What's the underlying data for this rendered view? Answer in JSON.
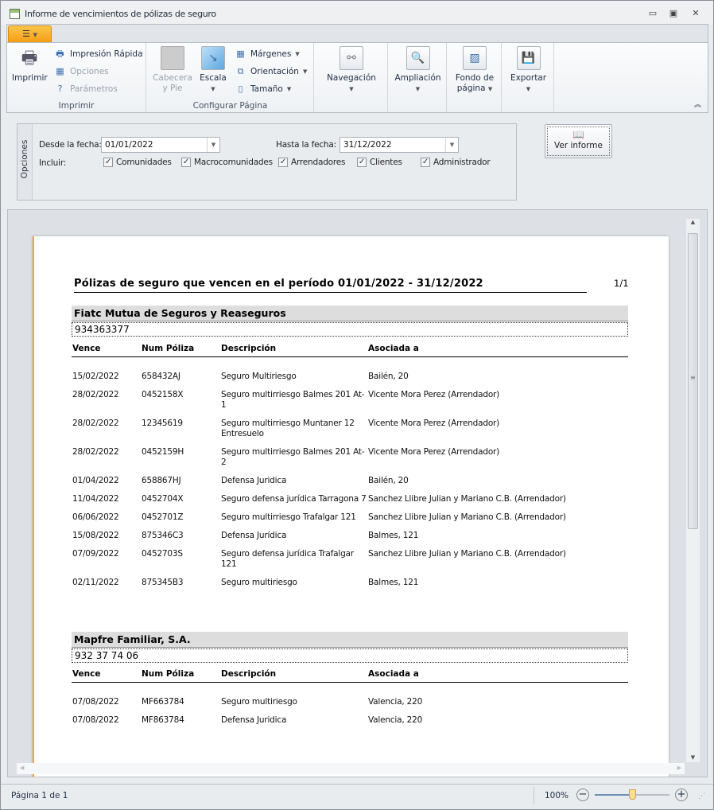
{
  "window": {
    "title": "Informe de vencimientos de pólizas de seguro"
  },
  "ribbon": {
    "imprimir_group": {
      "label": "Imprimir",
      "print": "Imprimir",
      "quick_print": "Impresión Rápida",
      "options": "Opciones",
      "parameters": "Parámetros"
    },
    "config_group": {
      "label": "Configurar Página",
      "header_footer_1": "Cabecera",
      "header_footer_2": "y Pie",
      "scale": "Escala",
      "margins": "Márgenes",
      "orientation": "Orientación",
      "size": "Tamaño"
    },
    "navigation": "Navegación",
    "zoom": "Ampliación",
    "background_1": "Fondo de",
    "background_2": "página",
    "export": "Exportar"
  },
  "options": {
    "panel_label": "Opciones",
    "from_label": "Desde la fecha:",
    "from_value": "01/01/2022",
    "to_label": "Hasta la fecha:",
    "to_value": "31/12/2022",
    "include_label": "Incluir:",
    "checks": [
      {
        "label": "Comunidades",
        "checked": true
      },
      {
        "label": "Macrocomunidades",
        "checked": true
      },
      {
        "label": "Arrendadores",
        "checked": true
      },
      {
        "label": "Clientes",
        "checked": true
      },
      {
        "label": "Administrador",
        "checked": true
      }
    ],
    "view_report": "Ver informe"
  },
  "report": {
    "title": "Pólizas de seguro que vencen en el período 01/01/2022 - 31/12/2022",
    "page": "1/1",
    "columns": [
      "Vence",
      "Num Póliza",
      "Descripción",
      "Asociada a"
    ],
    "groups": [
      {
        "name": "Fiatc Mutua de Seguros y Reaseguros",
        "phone": "934363377",
        "rows": [
          [
            "15/02/2022",
            "658432AJ",
            "Seguro Multiriesgo",
            "Bailén, 20"
          ],
          [
            "28/02/2022",
            "0452158X",
            "Seguro multirriesgo Balmes 201 At-1",
            "Vicente Mora Perez (Arrendador)"
          ],
          [
            "28/02/2022",
            "12345619",
            "Seguro multirriesgo Muntaner 12 Entresuelo",
            "Vicente Mora Perez (Arrendador)"
          ],
          [
            "28/02/2022",
            "0452159H",
            "Seguro multirriesgo Balmes 201 At-2",
            "Vicente Mora Perez (Arrendador)"
          ],
          [
            "01/04/2022",
            "658867HJ",
            "Defensa Juridica",
            "Bailén, 20"
          ],
          [
            "11/04/2022",
            "0452704X",
            "Seguro defensa jurídica Tarragona 7",
            "Sanchez Llibre Julian y Mariano C.B. (Arrendador)"
          ],
          [
            "06/06/2022",
            "0452701Z",
            "Seguro multirriesgo Trafalgar 121",
            "Sanchez Llibre Julian y Mariano C.B. (Arrendador)"
          ],
          [
            "15/08/2022",
            "875346C3",
            "Defensa Jurídica",
            "Balmes, 121"
          ],
          [
            "07/09/2022",
            "0452703S",
            "Seguro defensa jurídica Trafalgar 121",
            "Sanchez Llibre Julian y Mariano C.B. (Arrendador)"
          ],
          [
            "02/11/2022",
            "875345B3",
            "Seguro multiriesgo",
            "Balmes, 121"
          ]
        ]
      },
      {
        "name": "Mapfre Familiar, S.A.",
        "phone": "932 37 74 06",
        "rows": [
          [
            "07/08/2022",
            "MF663784",
            "Seguro multiriesgo",
            "Valencia, 220"
          ],
          [
            "07/08/2022",
            "MF863784",
            "Defensa Juridica",
            "Valencia, 220"
          ]
        ]
      }
    ]
  },
  "status": {
    "page_info": "Página 1 de 1",
    "zoom": "100%",
    "zoom_fraction": 0.5
  }
}
